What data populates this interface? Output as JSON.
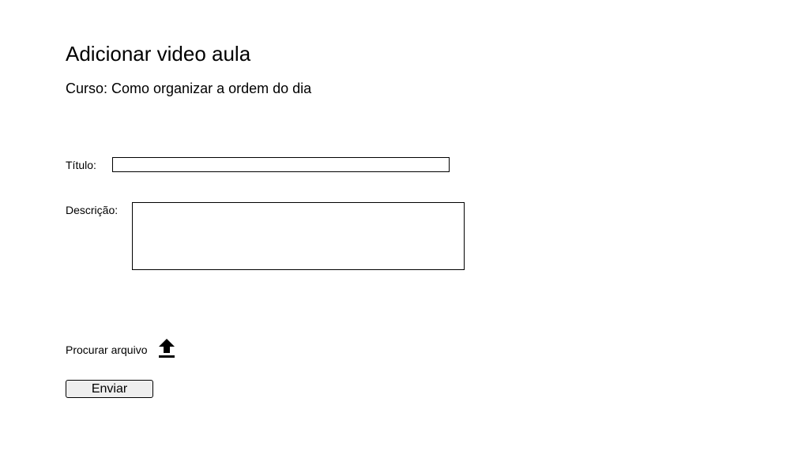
{
  "page": {
    "title": "Adicionar video aula",
    "course_line": "Curso: Como organizar a ordem do dia"
  },
  "form": {
    "title_label": "Título:",
    "title_value": "",
    "description_label": "Descrição:",
    "description_value": "",
    "browse_label": "Procurar arquivo",
    "upload_icon": "upload-icon",
    "submit_label": "Enviar"
  },
  "colors": {
    "text": "#000000",
    "background": "#ffffff",
    "button_background": "#eeeeee",
    "border": "#000000"
  }
}
